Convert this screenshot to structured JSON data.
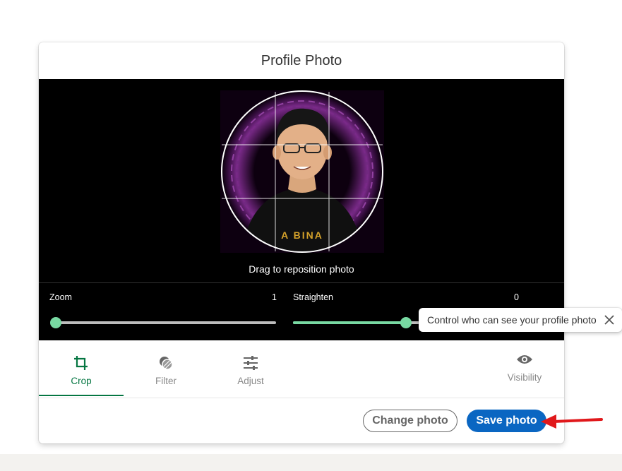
{
  "modal": {
    "title": "Profile Photo"
  },
  "editor": {
    "drag_hint": "Drag to reposition photo",
    "zoom": {
      "label": "Zoom",
      "value": "1",
      "fraction": 0.0
    },
    "straighten": {
      "label": "Straighten",
      "value": "0",
      "fraction": 0.5
    },
    "photo_caption": "A BINA"
  },
  "tabs": [
    {
      "label": "Crop",
      "icon": "crop-icon",
      "active": true
    },
    {
      "label": "Filter",
      "icon": "filter-icon",
      "active": false
    },
    {
      "label": "Adjust",
      "icon": "sliders-icon",
      "active": false
    }
  ],
  "visibility": {
    "label": "Visibility",
    "icon": "eye-icon"
  },
  "footer": {
    "change_label": "Change photo",
    "save_label": "Save photo"
  },
  "tooltip": {
    "text": "Control who can see your profile photo"
  },
  "colors": {
    "accent_green": "#057642",
    "slider_green": "#78d9a2",
    "primary_blue": "#0a66c2",
    "arrow_red": "#e0181b"
  }
}
